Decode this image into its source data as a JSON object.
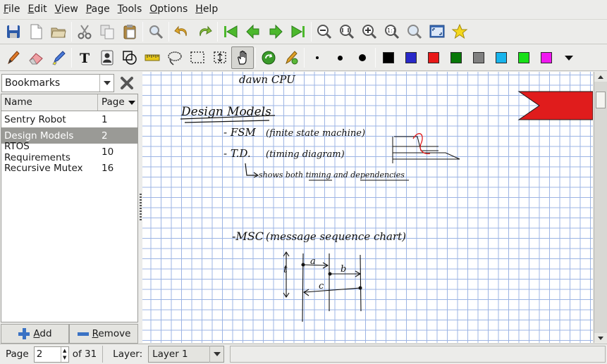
{
  "menu": [
    "File",
    "Edit",
    "View",
    "Page",
    "Tools",
    "Options",
    "Help"
  ],
  "toolbar1": [
    {
      "icon": "save-icon"
    },
    {
      "icon": "new-document-icon"
    },
    {
      "icon": "open-folder-icon"
    },
    {
      "sep": true
    },
    {
      "icon": "cut-icon"
    },
    {
      "icon": "copy-icon"
    },
    {
      "icon": "paste-icon"
    },
    {
      "sep": true
    },
    {
      "icon": "find-icon"
    },
    {
      "sep": true
    },
    {
      "icon": "undo-icon"
    },
    {
      "icon": "redo-icon"
    },
    {
      "sep": true
    },
    {
      "icon": "first-page-icon"
    },
    {
      "icon": "previous-page-icon"
    },
    {
      "icon": "next-page-icon"
    },
    {
      "icon": "last-page-icon"
    },
    {
      "sep": true
    },
    {
      "icon": "zoom-out-icon"
    },
    {
      "icon": "zoom-fit-icon"
    },
    {
      "icon": "zoom-in-icon"
    },
    {
      "icon": "zoom-100-icon"
    },
    {
      "icon": "zoom-find-icon"
    },
    {
      "icon": "fullscreen-icon"
    },
    {
      "icon": "bookmark-star-icon"
    }
  ],
  "toolbar2_tools": [
    "pen-icon",
    "eraser-icon",
    "highlighter-icon",
    "text-tool-icon",
    "image-tool-icon",
    "shape-recognizer-icon",
    "ruler-icon",
    "select-region-icon",
    "select-rectangle-icon",
    "vertical-space-icon",
    "hand-tool-icon",
    "default-pen-icon",
    "pen-settings-icon"
  ],
  "pen_sizes": [
    "thin",
    "medium",
    "thick"
  ],
  "colors": [
    "#000000",
    "#2828c8",
    "#e81818",
    "#087808",
    "#808080",
    "#18b4ec",
    "#18e018",
    "#f018f0"
  ],
  "sidebar": {
    "combo_label": "Bookmarks",
    "col_name": "Name",
    "col_page": "Page",
    "bookmarks": [
      {
        "name": "Sentry Robot",
        "page": "1"
      },
      {
        "name": "Design Models",
        "page": "2"
      },
      {
        "name": "RTOS Requirements",
        "page": "10"
      },
      {
        "name": "Recursive Mutex",
        "page": "16"
      }
    ],
    "selected_index": 1,
    "add_label": "Add",
    "remove_label": "Remove"
  },
  "note": {
    "line0": "dawn CPU",
    "heading": "Design Models",
    "item1": "- FSM",
    "item1_note": "(finite state machine)",
    "item2": "- T.D.",
    "item2_note": "(timing diagram)",
    "arrow_note": "shows both timing and dependencies",
    "item3": "-MSC",
    "item3_note": "(message sequence chart)",
    "msg_a": "a",
    "msg_b": "b",
    "msg_c": "c",
    "axis_t": "t"
  },
  "status": {
    "page_label": "Page",
    "page_value": "2",
    "of_pages": "of 31",
    "layer_label": "Layer:",
    "layer_value": "Layer 1"
  }
}
